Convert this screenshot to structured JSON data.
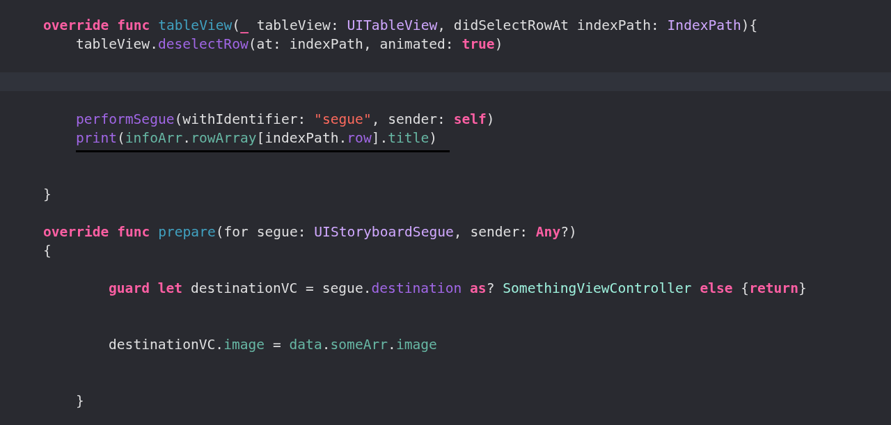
{
  "editor": {
    "lines": [
      {
        "kind": "code",
        "tokens": [
          {
            "kind": "keyword",
            "text": "override func "
          },
          {
            "kind": "decl",
            "text": "tableView"
          },
          {
            "kind": "plain",
            "text": "("
          },
          {
            "kind": "keyword",
            "text": "_"
          },
          {
            "kind": "plain",
            "text": " tableView: "
          },
          {
            "kind": "type",
            "text": "UITableView"
          },
          {
            "kind": "plain",
            "text": ", didSelectRowAt indexPath: "
          },
          {
            "kind": "type",
            "text": "IndexPath"
          },
          {
            "kind": "plain",
            "text": "){"
          }
        ],
        "children": [
          {
            "kind": "code",
            "tokens": [
              {
                "kind": "plain",
                "text": "tableView."
              },
              {
                "kind": "method",
                "text": "deselectRow"
              },
              {
                "kind": "plain",
                "text": "(at: indexPath, animated: "
              },
              {
                "kind": "keyword",
                "text": "true"
              },
              {
                "kind": "plain",
                "text": ")"
              }
            ]
          },
          {
            "kind": "blank"
          },
          {
            "kind": "blank",
            "current": true
          },
          {
            "kind": "blank"
          },
          {
            "kind": "code",
            "tokens": [
              {
                "kind": "method",
                "text": "performSegue"
              },
              {
                "kind": "plain",
                "text": "(withIdentifier: "
              },
              {
                "kind": "string",
                "text": "\"segue\""
              },
              {
                "kind": "plain",
                "text": ", sender: "
              },
              {
                "kind": "keyword",
                "text": "self"
              },
              {
                "kind": "plain",
                "text": ")"
              }
            ]
          },
          {
            "kind": "code",
            "underlined": true,
            "tokens": [
              {
                "kind": "method",
                "text": "print"
              },
              {
                "kind": "plain",
                "text": "("
              },
              {
                "kind": "prop",
                "text": "infoArr"
              },
              {
                "kind": "plain",
                "text": "."
              },
              {
                "kind": "prop",
                "text": "rowArray"
              },
              {
                "kind": "plain",
                "text": "[indexPath."
              },
              {
                "kind": "method",
                "text": "row"
              },
              {
                "kind": "plain",
                "text": "]."
              },
              {
                "kind": "prop",
                "text": "title"
              },
              {
                "kind": "plain",
                "text": ")"
              }
            ]
          },
          {
            "kind": "blank"
          },
          {
            "kind": "blank"
          }
        ]
      },
      {
        "kind": "code",
        "tokens": [
          {
            "kind": "plain",
            "text": "}"
          }
        ]
      },
      {
        "kind": "blank"
      },
      {
        "kind": "code",
        "tokens": [
          {
            "kind": "keyword",
            "text": "override func "
          },
          {
            "kind": "decl",
            "text": "prepare"
          },
          {
            "kind": "plain",
            "text": "(for segue: "
          },
          {
            "kind": "type",
            "text": "UIStoryboardSegue"
          },
          {
            "kind": "plain",
            "text": ", sender: "
          },
          {
            "kind": "keyword",
            "text": "Any"
          },
          {
            "kind": "plain",
            "text": "?)"
          }
        ]
      },
      {
        "kind": "code",
        "tokens": [
          {
            "kind": "plain",
            "text": "{"
          }
        ],
        "children": [
          {
            "kind": "blank",
            "children": [
              {
                "kind": "code",
                "tokens": [
                  {
                    "kind": "keyword",
                    "text": "guard let"
                  },
                  {
                    "kind": "plain",
                    "text": " destinationVC = segue."
                  },
                  {
                    "kind": "method",
                    "text": "destination "
                  },
                  {
                    "kind": "keyword",
                    "text": "as"
                  },
                  {
                    "kind": "plain",
                    "text": "? "
                  },
                  {
                    "kind": "class",
                    "text": "SomethingViewController "
                  },
                  {
                    "kind": "keyword",
                    "text": "else"
                  },
                  {
                    "kind": "plain",
                    "text": " {"
                  },
                  {
                    "kind": "keyword",
                    "text": "return"
                  },
                  {
                    "kind": "plain",
                    "text": "}"
                  }
                ]
              },
              {
                "kind": "blank"
              },
              {
                "kind": "blank"
              },
              {
                "kind": "code",
                "tokens": [
                  {
                    "kind": "plain",
                    "text": "destinationVC."
                  },
                  {
                    "kind": "prop",
                    "text": "image"
                  },
                  {
                    "kind": "plain",
                    "text": " = "
                  },
                  {
                    "kind": "prop",
                    "text": "data"
                  },
                  {
                    "kind": "plain",
                    "text": "."
                  },
                  {
                    "kind": "prop",
                    "text": "someArr"
                  },
                  {
                    "kind": "plain",
                    "text": "."
                  },
                  {
                    "kind": "prop",
                    "text": "image"
                  }
                ]
              },
              {
                "kind": "blank"
              },
              {
                "kind": "blank"
              }
            ]
          },
          {
            "kind": "code",
            "tokens": [
              {
                "kind": "plain",
                "text": "}"
              }
            ]
          }
        ]
      }
    ]
  }
}
